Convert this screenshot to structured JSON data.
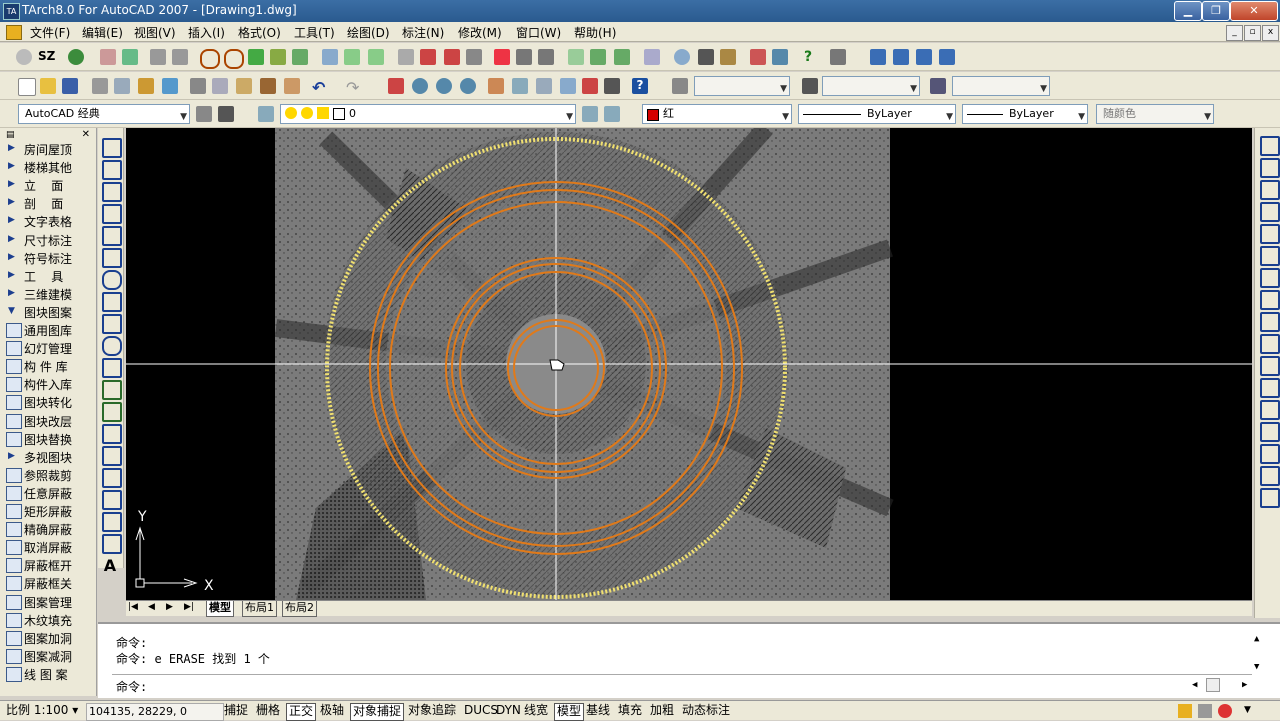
{
  "window": {
    "title": "TArch8.0 For AutoCAD 2007 - [Drawing1.dwg]",
    "logo": "TA"
  },
  "window_controls": {
    "minimize": "▁",
    "maximize": "❐",
    "close": "✕"
  },
  "menu": [
    "文件(F)",
    "编辑(E)",
    "视图(V)",
    "插入(I)",
    "格式(O)",
    "工具(T)",
    "绘图(D)",
    "标注(N)",
    "修改(M)",
    "窗口(W)",
    "帮助(H)"
  ],
  "toolbar1": {
    "sz": "SZ"
  },
  "toolbar3": {
    "workspace": "AutoCAD 经典",
    "layer": "0",
    "color": "红",
    "color_hex": "#d40000",
    "linetype": "ByLayer",
    "lineweight": "ByLayer",
    "plotstyle": "随颜色"
  },
  "left_panel": [
    {
      "label": "房间屋顶",
      "type": "item"
    },
    {
      "label": "楼梯其他",
      "type": "item"
    },
    {
      "label": "立    面",
      "type": "item"
    },
    {
      "label": "剖    面",
      "type": "item"
    },
    {
      "label": "文字表格",
      "type": "item"
    },
    {
      "label": "尺寸标注",
      "type": "item"
    },
    {
      "label": "符号标注",
      "type": "item"
    },
    {
      "label": "工    具",
      "type": "item"
    },
    {
      "label": "三维建模",
      "type": "item"
    },
    {
      "label": "图块图案",
      "type": "open"
    },
    {
      "label": "通用图库",
      "type": "icon"
    },
    {
      "label": "幻灯管理",
      "type": "icon"
    },
    {
      "label": "构 件 库",
      "type": "icon"
    },
    {
      "label": "构件入库",
      "type": "icon"
    },
    {
      "label": "图块转化",
      "type": "icon"
    },
    {
      "label": "图块改层",
      "type": "icon"
    },
    {
      "label": "图块替换",
      "type": "icon"
    },
    {
      "label": "多视图块",
      "type": "item"
    },
    {
      "label": "参照裁剪",
      "type": "icon"
    },
    {
      "label": "任意屏蔽",
      "type": "icon"
    },
    {
      "label": "矩形屏蔽",
      "type": "icon"
    },
    {
      "label": "精确屏蔽",
      "type": "icon"
    },
    {
      "label": "取消屏蔽",
      "type": "icon"
    },
    {
      "label": "屏蔽框开",
      "type": "icon"
    },
    {
      "label": "屏蔽框关",
      "type": "icon"
    },
    {
      "label": "图案管理",
      "type": "icon"
    },
    {
      "label": "木纹填充",
      "type": "icon"
    },
    {
      "label": "图案加洞",
      "type": "icon"
    },
    {
      "label": "图案减洞",
      "type": "icon"
    },
    {
      "label": "线 图 案",
      "type": "icon"
    }
  ],
  "draw_tools": [
    "line-icon",
    "xline-icon",
    "pline-icon",
    "polygon-icon",
    "rectangle-icon",
    "arc-icon",
    "circle-icon",
    "revcloud-icon",
    "spline-icon",
    "ellipse-icon",
    "ellipse-arc-icon",
    "insert-block-icon",
    "make-block-icon",
    "point-icon",
    "hatch-icon",
    "gradient-icon",
    "region-icon",
    "table-icon",
    "mtext-icon"
  ],
  "draw_text_tool": "A",
  "canvas": {
    "ucs_x": "X",
    "ucs_y": "Y"
  },
  "layout_tabs": [
    "模型",
    "布局1",
    "布局2"
  ],
  "command": {
    "line1": "命令:",
    "line2": "命令: e ERASE 找到 1 个",
    "prompt": "命令:"
  },
  "status": {
    "scale": "比例 1:100",
    "coords": "104135, 28229, 0",
    "toggles": [
      {
        "label": "捕捉",
        "on": false
      },
      {
        "label": "栅格",
        "on": false
      },
      {
        "label": "正交",
        "on": true
      },
      {
        "label": "极轴",
        "on": false
      },
      {
        "label": "对象捕捉",
        "on": true
      },
      {
        "label": "对象追踪",
        "on": false
      },
      {
        "label": "DUCS",
        "on": false
      },
      {
        "label": "DYN",
        "on": false
      },
      {
        "label": "线宽",
        "on": false
      },
      {
        "label": "模型",
        "on": true
      },
      {
        "label": "基线",
        "on": false
      },
      {
        "label": "填充",
        "on": false
      },
      {
        "label": "加粗",
        "on": false
      },
      {
        "label": "动态标注",
        "on": false
      }
    ]
  }
}
